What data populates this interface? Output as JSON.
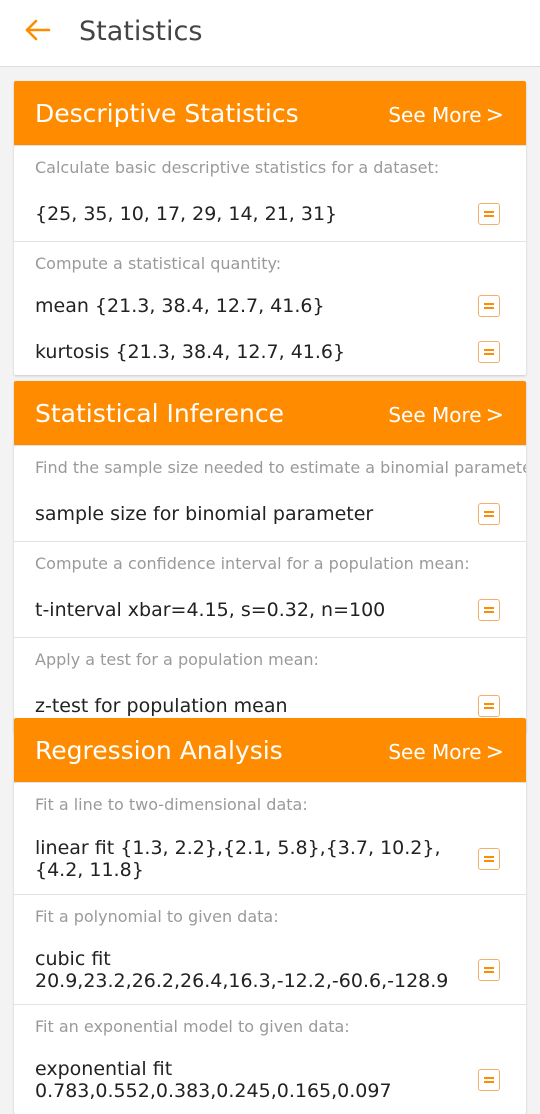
{
  "appbar": {
    "title": "Statistics"
  },
  "colors": {
    "accent": "#ff8c00"
  },
  "cards": [
    {
      "title": "Descriptive Statistics",
      "see_more": "See More",
      "sections": [
        {
          "caption": "Calculate basic descriptive statistics for a dataset:",
          "entries": [
            "{25, 35, 10, 17, 29, 14, 21, 31}"
          ]
        },
        {
          "caption": "Compute a statistical quantity:",
          "entries": [
            "mean {21.3, 38.4, 12.7, 41.6}",
            "kurtosis {21.3, 38.4, 12.7, 41.6}"
          ]
        }
      ]
    },
    {
      "title": "Statistical Inference",
      "see_more": "See More",
      "sections": [
        {
          "caption": "Find the sample size needed to estimate a binomial parameter:",
          "entries": [
            "sample size for binomial parameter"
          ]
        },
        {
          "caption": "Compute a confidence interval for a population mean:",
          "entries": [
            "t-interval xbar=4.15, s=0.32, n=100"
          ]
        },
        {
          "caption": "Apply a test for a population mean:",
          "entries": [
            "z-test for population mean"
          ]
        }
      ]
    },
    {
      "title": "Regression Analysis",
      "see_more": "See More",
      "sections": [
        {
          "caption": "Fit a line to two-dimensional data:",
          "entries": [
            "linear fit {1.3, 2.2},{2.1, 5.8},{3.7, 10.2},{4.2, 11.8}"
          ]
        },
        {
          "caption": "Fit a polynomial to given data:",
          "entries": [
            "cubic fit 20.9,23.2,26.2,26.4,16.3,-12.2,-60.6,-128.9"
          ]
        },
        {
          "caption": "Fit an exponential model to given data:",
          "entries": [
            "exponential fit 0.783,0.552,0.383,0.245,0.165,0.097"
          ]
        }
      ]
    }
  ]
}
